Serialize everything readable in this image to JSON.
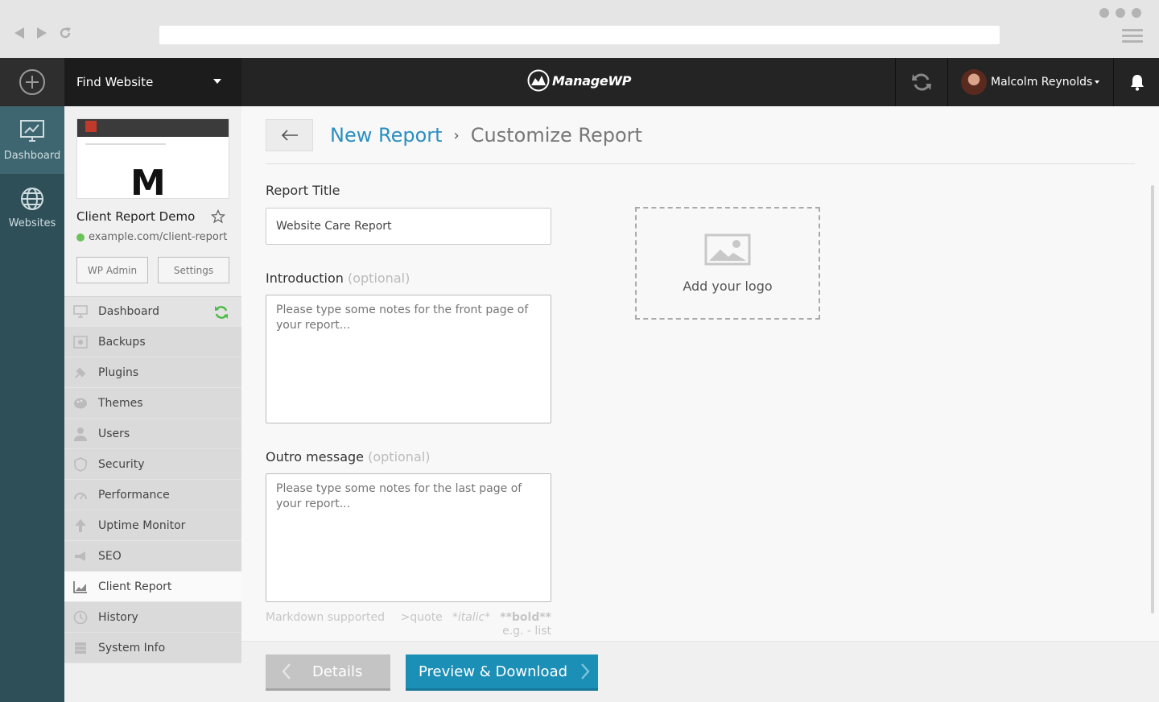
{
  "header": {
    "find_website": "Find Website",
    "brand": "ManageWP",
    "user_name": "Malcolm Reynolds"
  },
  "rail": {
    "items": [
      {
        "label": "Dashboard",
        "icon": "chart-monitor-icon"
      },
      {
        "label": "Websites",
        "icon": "globe-icon"
      }
    ]
  },
  "site": {
    "name": "Client Report Demo",
    "url": "example.com/client-report",
    "wp_admin": "WP Admin",
    "settings": "Settings",
    "menu": [
      {
        "label": "Dashboard",
        "icon": "monitor-icon"
      },
      {
        "label": "Backups",
        "icon": "backup-icon"
      },
      {
        "label": "Plugins",
        "icon": "plug-icon"
      },
      {
        "label": "Themes",
        "icon": "palette-icon"
      },
      {
        "label": "Users",
        "icon": "user-icon"
      },
      {
        "label": "Security",
        "icon": "shield-icon"
      },
      {
        "label": "Performance",
        "icon": "gauge-icon"
      },
      {
        "label": "Uptime Monitor",
        "icon": "arrow-up-icon"
      },
      {
        "label": "SEO",
        "icon": "megaphone-icon"
      },
      {
        "label": "Client Report",
        "icon": "chart-icon"
      },
      {
        "label": "History",
        "icon": "clock-icon"
      },
      {
        "label": "System Info",
        "icon": "server-icon"
      }
    ]
  },
  "breadcrumb": {
    "link": "New Report",
    "sep": "›",
    "current": "Customize Report"
  },
  "form": {
    "title_label": "Report Title",
    "title_value": "Website Care Report",
    "intro_label": "Introduction",
    "intro_optional": "(optional)",
    "intro_placeholder": "Please type some notes for the front page of your report...",
    "outro_label": "Outro message",
    "outro_optional": "(optional)",
    "outro_placeholder": "Please type some notes for the last page of your report...",
    "logo_label": "Add your logo",
    "markdown_supported": "Markdown supported",
    "md_quote": ">quote",
    "md_italic": "*italic*",
    "md_bold": "**bold**",
    "md_eg": "e.g.  - list"
  },
  "footer": {
    "back_label": "Details",
    "next_label": "Preview & Download"
  },
  "colors": {
    "accent": "#1b8fb6",
    "link": "#2c8fc0",
    "rail": "#2f4f58",
    "sync_green": "#4cbb47"
  }
}
